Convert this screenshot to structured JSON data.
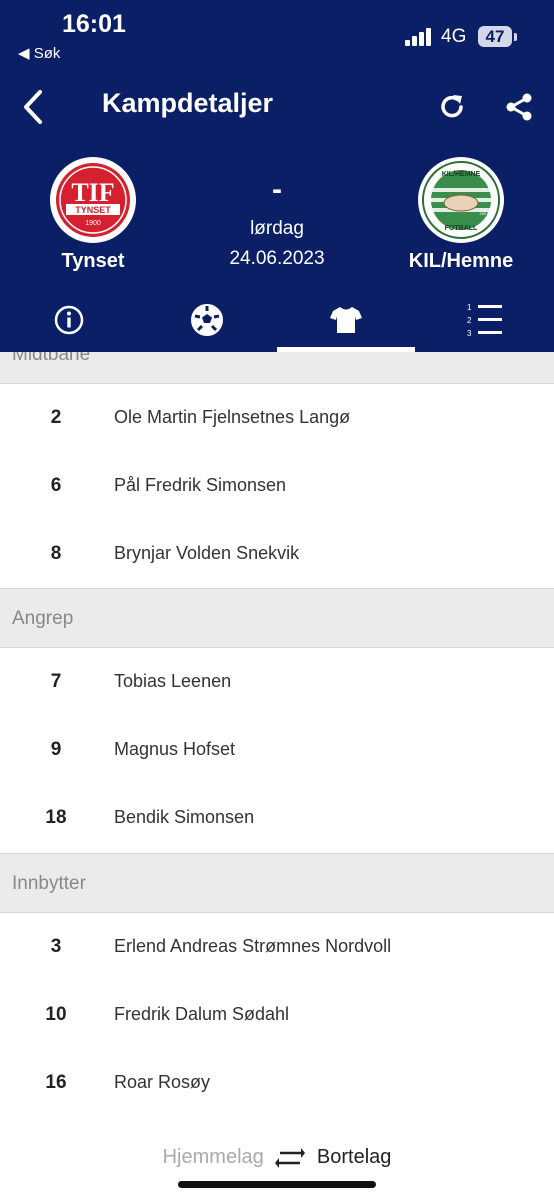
{
  "status_bar": {
    "time": "16:01",
    "back_app": "◀ Søk",
    "network": "4G",
    "battery": "47"
  },
  "nav": {
    "title": "Kampdetaljer",
    "back_icon": "chevron-left-icon",
    "refresh_icon": "refresh-icon",
    "share_icon": "share-icon"
  },
  "match": {
    "home_team": "Tynset",
    "away_team": "KIL/Hemne",
    "score": "-",
    "day": "lørdag",
    "date": "24.06.2023",
    "home_logo": {
      "top": "TIF",
      "band": "TYNSET",
      "year": "1900",
      "color": "#d4202f"
    },
    "away_logo": {
      "top": "KIL/HEMNE",
      "bottom": "FOTBALL",
      "left_year": "2007",
      "color": "#3a8d4a"
    }
  },
  "tabs": [
    {
      "icon": "info-icon",
      "active": false
    },
    {
      "icon": "football-icon",
      "active": false
    },
    {
      "icon": "jersey-icon",
      "active": true
    },
    {
      "icon": "ranked-list-icon",
      "active": false
    }
  ],
  "lineup": {
    "sections": [
      {
        "title": "Midtbane",
        "players": [
          {
            "number": "2",
            "name": "Ole Martin Fjelnsetnes Langø"
          },
          {
            "number": "6",
            "name": "Pål Fredrik Simonsen"
          },
          {
            "number": "8",
            "name": "Brynjar Volden Snekvik"
          }
        ]
      },
      {
        "title": "Angrep",
        "players": [
          {
            "number": "7",
            "name": "Tobias Leenen"
          },
          {
            "number": "9",
            "name": "Magnus Hofset"
          },
          {
            "number": "18",
            "name": "Bendik Simonsen"
          }
        ]
      },
      {
        "title": "Innbytter",
        "players": [
          {
            "number": "3",
            "name": "Erlend Andreas Strømnes Nordvoll"
          },
          {
            "number": "10",
            "name": "Fredrik Dalum Sødahl"
          },
          {
            "number": "16",
            "name": "Roar Rosøy"
          }
        ]
      }
    ]
  },
  "switcher": {
    "home_label": "Hjemmelag",
    "away_label": "Bortelag",
    "swap_icon": "swap-arrows-icon"
  },
  "colors": {
    "header": "#0b1f66",
    "section_bg": "#ebebeb"
  }
}
